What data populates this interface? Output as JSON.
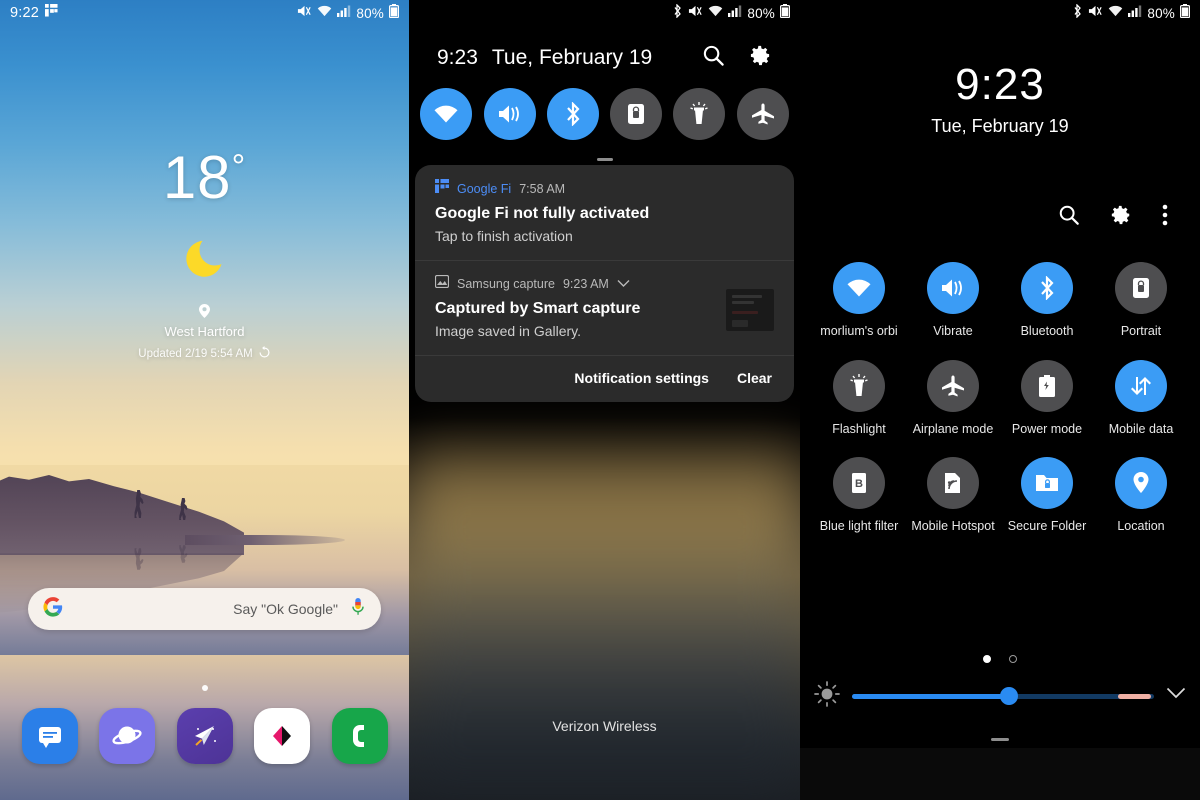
{
  "statusbar": {
    "time": "9:22",
    "battery_percent": "80%",
    "icons": [
      "google-fi-icon",
      "mute-icon",
      "wifi-icon",
      "signal-icon",
      "battery-icon"
    ]
  },
  "home": {
    "weather": {
      "temperature": "18",
      "degree": "°",
      "condition_icon": "moon-icon",
      "location": "West Hartford",
      "updated": "Updated 2/19 5:54 AM",
      "refresh_icon": "refresh-icon",
      "pin_icon": "location-pin-icon"
    },
    "search": {
      "logo": "google-g-icon",
      "hint": "Say \"Ok Google\"",
      "mic_icon": "microphone-icon"
    },
    "page_indicator": "1 of 1",
    "dock": [
      {
        "name": "messages",
        "label": "Messages",
        "icon": "message-bubble-icon"
      },
      {
        "name": "internet",
        "label": "Internet",
        "icon": "planet-icon"
      },
      {
        "name": "paper-plane",
        "label": "Paper plane app",
        "icon": "paper-plane-icon"
      },
      {
        "name": "gallery",
        "label": "Gallery",
        "icon": "pink-shape-icon"
      },
      {
        "name": "phone",
        "label": "Phone",
        "icon": "phone-handset-icon"
      }
    ]
  },
  "shade": {
    "statusbar": {
      "battery_percent": "80%"
    },
    "time": "9:23",
    "date": "Tue, February 19",
    "search_icon": "search-icon",
    "settings_icon": "gear-icon",
    "toggles": [
      {
        "label": "Wi-Fi",
        "icon": "wifi-icon",
        "state": "on"
      },
      {
        "label": "Vibrate",
        "icon": "vibrate-icon",
        "state": "on"
      },
      {
        "label": "Bluetooth",
        "icon": "bluetooth-icon",
        "state": "on"
      },
      {
        "label": "Portrait",
        "icon": "rotation-lock-icon",
        "state": "off"
      },
      {
        "label": "Flashlight",
        "icon": "flashlight-icon",
        "state": "off"
      },
      {
        "label": "Airplane mode",
        "icon": "airplane-icon",
        "state": "off"
      }
    ],
    "notifications": [
      {
        "app": "Google Fi",
        "app_icon": "google-fi-icon",
        "time": "7:58 AM",
        "title": "Google Fi not fully activated",
        "body": "Tap to finish activation",
        "has_thumbnail": false,
        "has_chevron": false
      },
      {
        "app": "Samsung capture",
        "app_icon": "image-icon",
        "time": "9:23 AM",
        "title": "Captured by Smart capture",
        "body": "Image saved in Gallery.",
        "has_thumbnail": true,
        "has_chevron": true
      }
    ],
    "actions": {
      "settings_label": "Notification settings",
      "clear_label": "Clear"
    },
    "carrier": "Verizon Wireless"
  },
  "quicksettings": {
    "statusbar": {
      "battery_percent": "80%"
    },
    "time": "9:23",
    "date": "Tue, February 19",
    "header_icons": [
      {
        "name": "search-icon"
      },
      {
        "name": "gear-icon"
      },
      {
        "name": "more-vertical-icon"
      }
    ],
    "tiles": [
      [
        {
          "label": "morlium's orbi",
          "icon": "wifi-icon",
          "state": "on"
        },
        {
          "label": "Vibrate",
          "icon": "vibrate-icon",
          "state": "on"
        },
        {
          "label": "Bluetooth",
          "icon": "bluetooth-icon",
          "state": "on"
        },
        {
          "label": "Portrait",
          "icon": "rotation-lock-icon",
          "state": "off"
        }
      ],
      [
        {
          "label": "Flashlight",
          "icon": "flashlight-icon",
          "state": "off"
        },
        {
          "label": "Airplane mode",
          "icon": "airplane-icon",
          "state": "off"
        },
        {
          "label": "Power mode",
          "icon": "power-mode-icon",
          "state": "off"
        },
        {
          "label": "Mobile data",
          "icon": "mobile-data-icon",
          "state": "on"
        }
      ],
      [
        {
          "label": "Blue light filter",
          "icon": "blue-light-icon",
          "state": "off"
        },
        {
          "label": "Mobile Hotspot",
          "icon": "hotspot-icon",
          "state": "off"
        },
        {
          "label": "Secure Folder",
          "icon": "secure-folder-icon",
          "state": "on"
        },
        {
          "label": "Location",
          "icon": "location-pin-icon",
          "state": "on"
        }
      ]
    ],
    "page_dots": {
      "count": 2,
      "active": 1
    },
    "brightness": {
      "icon": "brightness-icon",
      "value_percent": 52,
      "warm_start_percent": 88,
      "warm_end_percent": 99,
      "expand_icon": "chevron-down-icon"
    }
  },
  "colors": {
    "accent_blue": "#3b9cf5",
    "toggle_off": "#4e4e50",
    "shade_card": "#2b2b2b",
    "fi_blue": "#4c8df6",
    "warm_filter": "#f0b0a4"
  }
}
